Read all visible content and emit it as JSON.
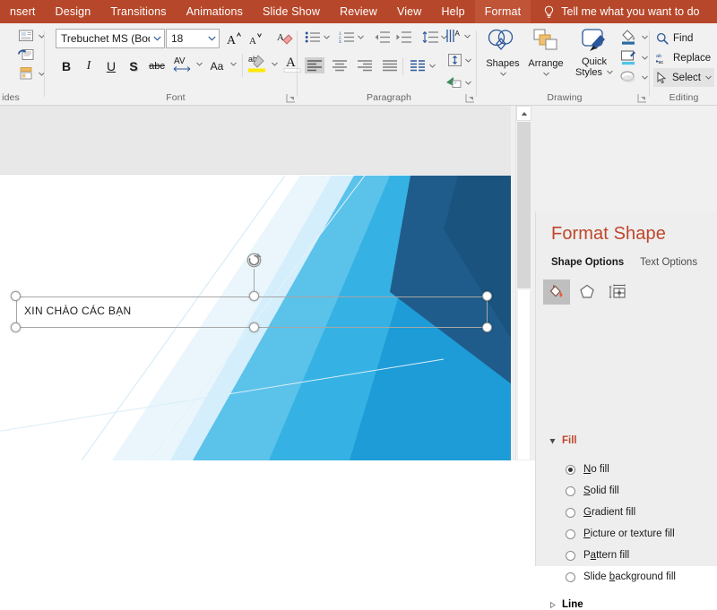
{
  "ribbon_tabs": [
    {
      "label": "nsert",
      "active": false
    },
    {
      "label": "Design",
      "active": false
    },
    {
      "label": "Transitions",
      "active": false
    },
    {
      "label": "Animations",
      "active": false
    },
    {
      "label": "Slide Show",
      "active": false
    },
    {
      "label": "Review",
      "active": false
    },
    {
      "label": "View",
      "active": false
    },
    {
      "label": "Help",
      "active": false
    },
    {
      "label": "Format",
      "active": true
    }
  ],
  "tell_me": {
    "label": "Tell me what you want to do",
    "icon": "lightbulb-icon"
  },
  "groups": {
    "slides": {
      "label": "ides"
    },
    "font": {
      "label": "Font",
      "font_name": "Trebuchet MS (Bod",
      "font_size": "18",
      "grow_font": "A",
      "shrink_font": "A",
      "clear_formatting": "A",
      "bold": "B",
      "italic": "I",
      "underline": "U",
      "shadow": "S",
      "strikethrough": "abc",
      "character_spacing": "AV",
      "change_case": "Aa",
      "text_highlight": "ab",
      "font_color": "A"
    },
    "paragraph": {
      "label": "Paragraph"
    },
    "drawing": {
      "label": "Drawing",
      "shapes": "Shapes",
      "arrange": "Arrange",
      "quick_styles": "Quick Styles"
    },
    "editing": {
      "label": "Editing",
      "find": "Find",
      "replace": "Replace",
      "select": "Select"
    }
  },
  "slide": {
    "textbox_text": "XIN CHÀO CÁC BẠN"
  },
  "panel": {
    "title": "Format Shape",
    "tabs": [
      {
        "label": "Shape Options",
        "active": true
      },
      {
        "label": "Text Options",
        "active": false
      }
    ],
    "icons": [
      {
        "name": "fill-line-icon",
        "selected": true
      },
      {
        "name": "effects-pentagon-icon",
        "selected": false
      },
      {
        "name": "size-properties-icon",
        "selected": false
      }
    ],
    "sections": [
      {
        "name": "Fill",
        "expanded": true
      },
      {
        "name": "Line",
        "expanded": false
      }
    ],
    "fill_options": [
      {
        "pre": "",
        "key": "N",
        "post": "o fill",
        "selected": true
      },
      {
        "pre": "",
        "key": "S",
        "post": "olid fill",
        "selected": false
      },
      {
        "pre": "",
        "key": "G",
        "post": "radient fill",
        "selected": false
      },
      {
        "pre": "",
        "key": "P",
        "post": "icture or texture fill",
        "selected": false
      },
      {
        "pre": "P",
        "key": "a",
        "post": "ttern fill",
        "selected": false
      },
      {
        "pre": "Slide ",
        "key": "b",
        "post": "ackground fill",
        "selected": false
      }
    ]
  },
  "colors": {
    "ribbon_red": "#b7472a",
    "tab_active": "#c05437",
    "panel_accent": "#c0462a",
    "slide_blue_dark": "#1f5c8b",
    "slide_blue_mid": "#1e9cd7",
    "slide_blue_light": "#5bc2ea"
  }
}
